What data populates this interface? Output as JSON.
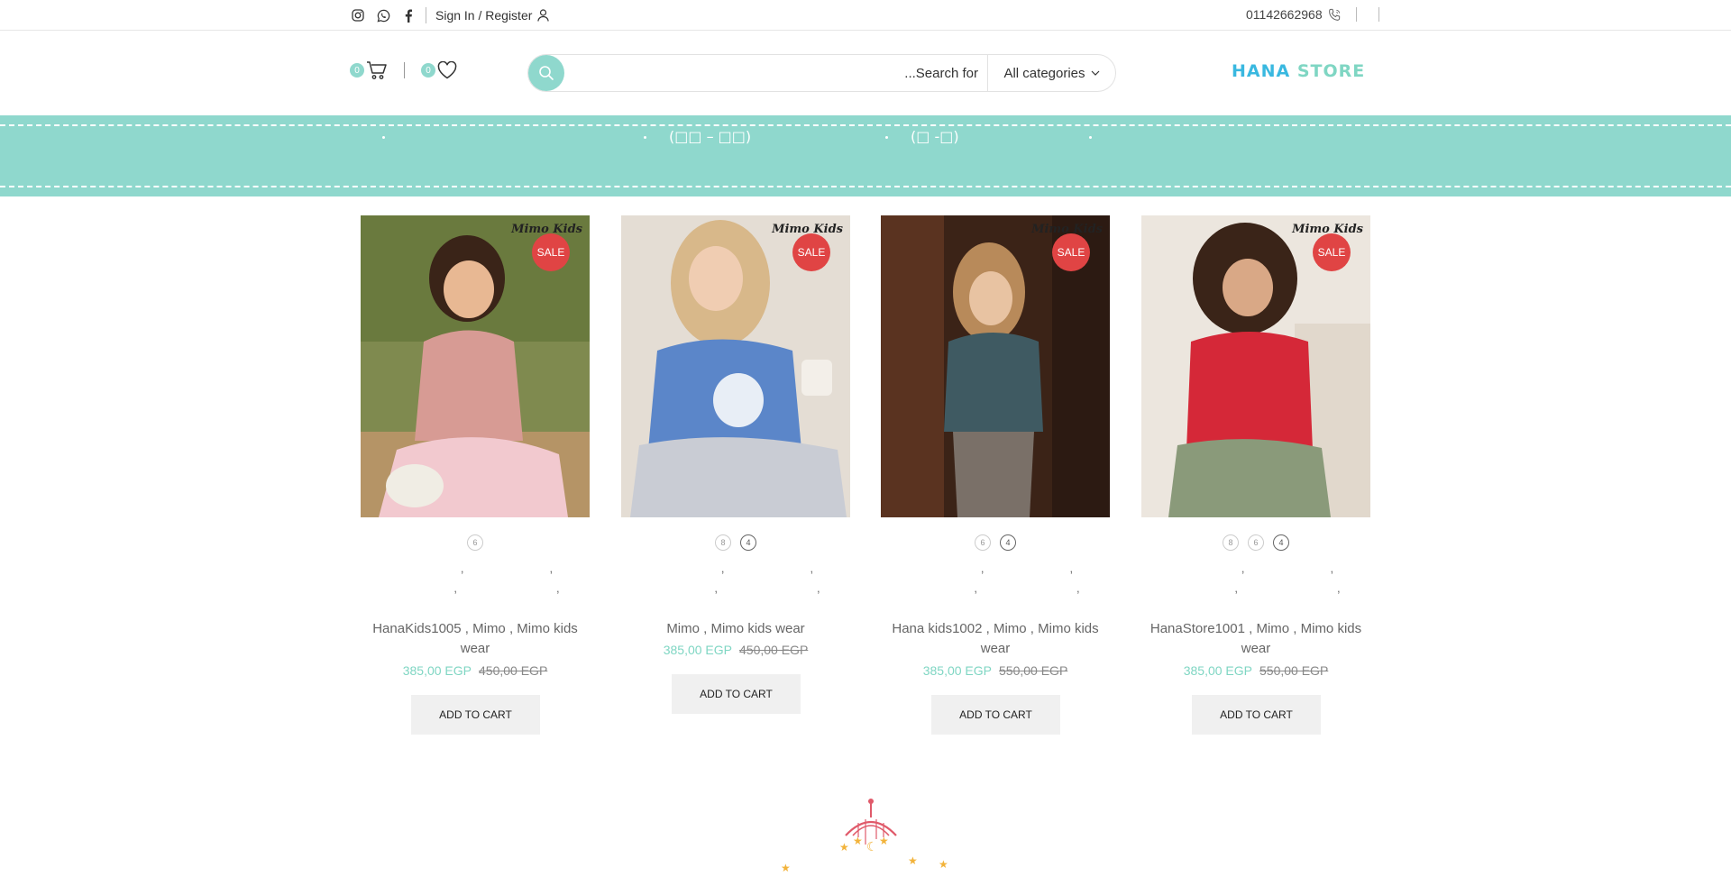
{
  "topbar": {
    "signin_label": "Sign In / Register",
    "phone": "01142662968",
    "social_icons": [
      "instagram-icon",
      "whatsapp-icon",
      "facebook-icon"
    ]
  },
  "header": {
    "cart_count": "0",
    "wishlist_count": "0",
    "search_placeholder": "Search for...",
    "category_select": "All categories",
    "logo_part1": "HANA",
    "logo_part2": "STORE"
  },
  "banner": {
    "text1": "(□□ – □□)",
    "text2": "(□ -□)"
  },
  "colors": {
    "accent": "#8fd8cd",
    "sale": "#e04444",
    "logo_blue": "#39b8e0",
    "logo_green": "#7fd6c3"
  },
  "products": [
    {
      "title": "HanaKids1005 , Mimo , Mimo kids wear",
      "brand_mark": "Mimo Kids",
      "sale_label": "SALE",
      "price_new": "385,00 EGP",
      "price_old": "450,00 EGP",
      "add_to_cart": "ADD TO CART",
      "sizes": [
        "6"
      ]
    },
    {
      "title": "Mimo , Mimo kids wear",
      "brand_mark": "Mimo Kids",
      "sale_label": "SALE",
      "price_new": "385,00 EGP",
      "price_old": "450,00 EGP",
      "add_to_cart": "ADD TO CART",
      "sizes": [
        "8",
        "4"
      ]
    },
    {
      "title": "Hana kids1002 , Mimo , Mimo kids wear",
      "brand_mark": "Mimo Kids",
      "sale_label": "SALE",
      "price_new": "385,00 EGP",
      "price_old": "550,00 EGP",
      "add_to_cart": "ADD TO CART",
      "sizes": [
        "6",
        "4"
      ]
    },
    {
      "title": "HanaStore1001 , Mimo , Mimo kids wear",
      "brand_mark": "Mimo Kids",
      "sale_label": "SALE",
      "price_new": "385,00 EGP",
      "price_old": "550,00 EGP",
      "add_to_cart": "ADD TO CART",
      "sizes": [
        "8",
        "6",
        "4"
      ]
    }
  ]
}
